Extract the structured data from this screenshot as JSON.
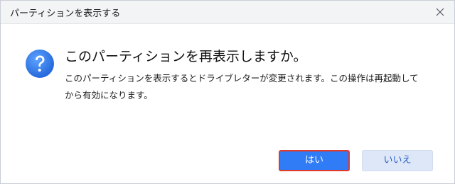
{
  "dialog": {
    "title": "パーティションを表示する",
    "heading": "このパーティションを再表示しますか。",
    "message": "このパーティションを表示するとドライブレターが変更されます。この操作は再起動してから有効になります。",
    "buttons": {
      "yes_label": "はい",
      "no_label": "いいえ"
    }
  },
  "icons": {
    "close": "close-icon",
    "help": "question-mark-icon"
  },
  "colors": {
    "titlebar_bg": "#f3f4f6",
    "primary_button": "#2f7cf6",
    "primary_highlight_border": "#e03b2a",
    "secondary_button": "#dde7f8",
    "secondary_text": "#2a5fc0",
    "help_icon": "#2f7cf6"
  }
}
